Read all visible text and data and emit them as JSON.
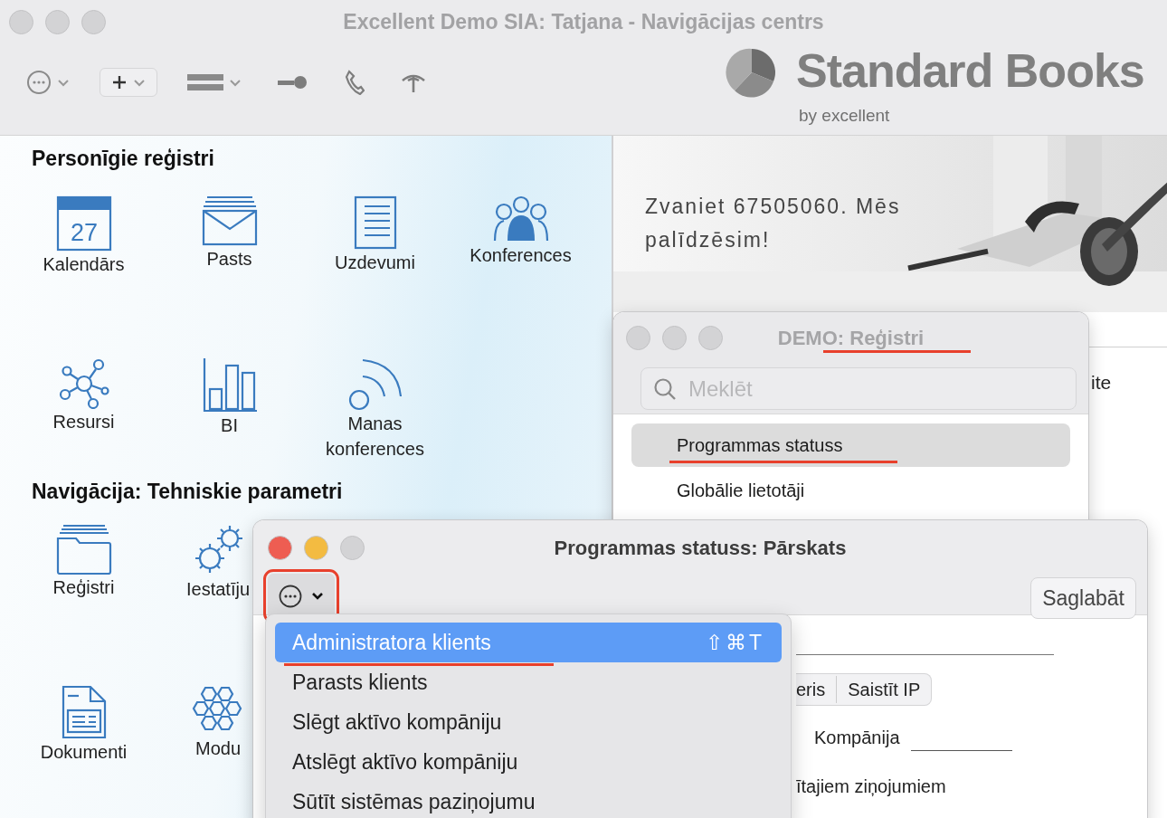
{
  "window": {
    "title": "Excellent Demo SIA: Tatjana - Navigācijas centrs",
    "active": false
  },
  "logo": {
    "name": "Standard Books",
    "tagline": "by excellent"
  },
  "sections": [
    {
      "title": "Personīgie reģistri",
      "tiles": [
        {
          "label": "Kalendārs",
          "kind": "calendar",
          "day": "27"
        },
        {
          "label": "Pasts",
          "kind": "mail"
        },
        {
          "label": "Uzdevumi",
          "kind": "tasks"
        },
        {
          "label": "Konferences",
          "kind": "people"
        },
        {
          "label": "Resursi",
          "kind": "network"
        },
        {
          "label": "BI",
          "kind": "chart"
        },
        {
          "label": "Manas konferences",
          "kind": "broadcast"
        }
      ]
    },
    {
      "title": "Navigācija: Tehniskie parametri",
      "tiles": [
        {
          "label": "Reģistri",
          "kind": "folder"
        },
        {
          "label": "Iestatīju",
          "kind": "gears"
        },
        {
          "label": "Dokumenti",
          "kind": "document"
        },
        {
          "label": "Modu",
          "kind": "hexagons"
        }
      ]
    }
  ],
  "banner": {
    "text": "Zvaniet 67505060. Mēs palīdzēsim!"
  },
  "background_text": "ite",
  "registers_window": {
    "title": "DEMO: Reģistri",
    "active": false,
    "title_underlined": true,
    "search": {
      "placeholder": "Meklēt"
    },
    "items": [
      {
        "label": "Programmas statuss",
        "selected": true,
        "underlined": true
      },
      {
        "label": "Globālie lietotāji",
        "selected": false,
        "underlined": false
      }
    ]
  },
  "status_window": {
    "title": "Programmas statuss: Pārskats",
    "active": true,
    "menu_button_outlined": true,
    "save_button": "Saglabāt",
    "menu": [
      {
        "label": "Administratora klients",
        "shortcut": "⇧⌘T",
        "selected": true,
        "underlined": true
      },
      {
        "label": "Parasts klients",
        "selected": false,
        "underlined": false
      },
      {
        "label": "Slēgt aktīvo kompāniju",
        "selected": false,
        "underlined": false
      },
      {
        "label": "Atslēgt aktīvo kompāniju",
        "selected": false,
        "underlined": false
      },
      {
        "label": "Sūtīt sistēmas paziņojumu",
        "selected": false,
        "underlined": false
      }
    ],
    "form": {
      "segments": [
        "eris",
        "Saistīt IP"
      ],
      "company_label": "Kompānija",
      "message_text": "ītajiem ziņojumiem"
    }
  }
}
